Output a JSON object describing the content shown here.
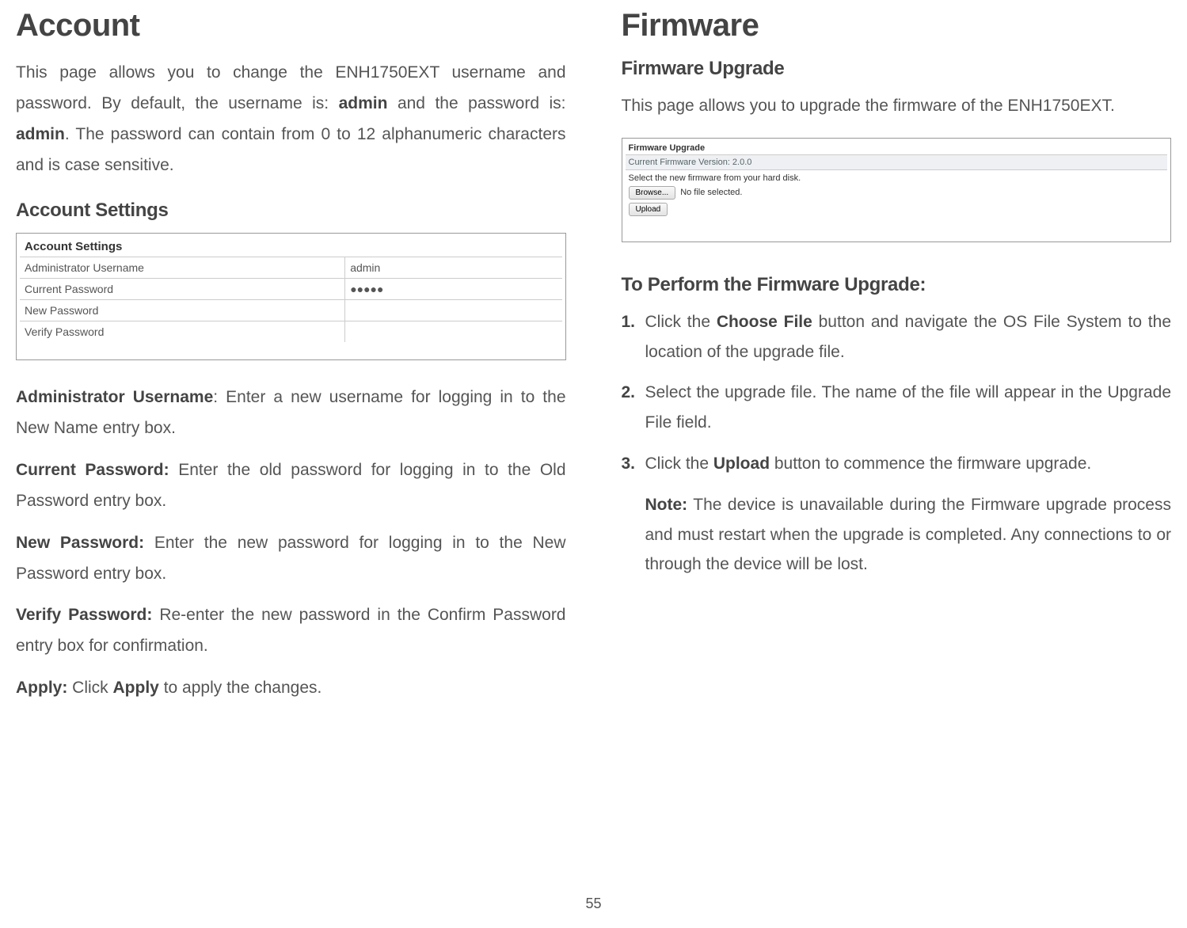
{
  "left": {
    "title": "Account",
    "intro_p1": "This page allows you to change the ENH1750EXT username and password. By default, the username is: ",
    "intro_b1": "admin",
    "intro_p2": " and the password is: ",
    "intro_b2": "admin",
    "intro_p3": ". The password can contain from 0 to 12 alphanumeric characters and is case sensitive.",
    "h2": "Account Settings",
    "ss": {
      "title": "Account Settings",
      "rows": [
        {
          "label": "Administrator Username",
          "value": "admin"
        },
        {
          "label": "Current Password",
          "value": "●●●●●"
        },
        {
          "label": "New Password",
          "value": ""
        },
        {
          "label": "Verify Password",
          "value": ""
        }
      ]
    },
    "defs": [
      {
        "term": "Administrator Username",
        "sep": ": ",
        "body": "Enter a new username for logging in to the New Name entry box."
      },
      {
        "term": "Current Password:",
        "sep": " ",
        "body": "Enter the old password for logging in to the Old Password entry box."
      },
      {
        "term": "New Password:",
        "sep": " ",
        "body": "Enter the new password for logging in to the New Password entry box."
      },
      {
        "term": "Verify Password:",
        "sep": " ",
        "body": "Re-enter the new password in the Confirm Password entry box for confirmation."
      },
      {
        "term": "Apply:",
        "sep": " ",
        "body_pre": "Click ",
        "body_b": "Apply",
        "body_post": " to apply the changes."
      }
    ]
  },
  "right": {
    "title": "Firmware",
    "h2a": "Firmware Upgrade",
    "intro": "This page allows you to upgrade the firmware of the ENH1750EXT.",
    "ss": {
      "title": "Firmware Upgrade",
      "version": "Current Firmware Version: 2.0.0",
      "instr": "Select the new firmware from your hard disk.",
      "browse": "Browse...",
      "nofile": "No file selected.",
      "upload": "Upload"
    },
    "h2b": "To Perform the Firmware Upgrade:",
    "steps": [
      {
        "n": "1.",
        "pre": "Click the ",
        "b": "Choose File",
        "post": " button and navigate the OS File System to the location of the upgrade file."
      },
      {
        "n": "2.",
        "pre": "Select the upgrade file. The name of the file will appear in the Upgrade File field.",
        "b": "",
        "post": ""
      },
      {
        "n": "3.",
        "pre": "Click the ",
        "b": "Upload",
        "post": " button to commence the firmware upgrade."
      }
    ],
    "note_label": "Note:",
    "note_body": " The device is unavailable during the Firmware upgrade process and must restart when the upgrade is completed. Any connections to or through the device will be lost."
  },
  "page_number": "55"
}
